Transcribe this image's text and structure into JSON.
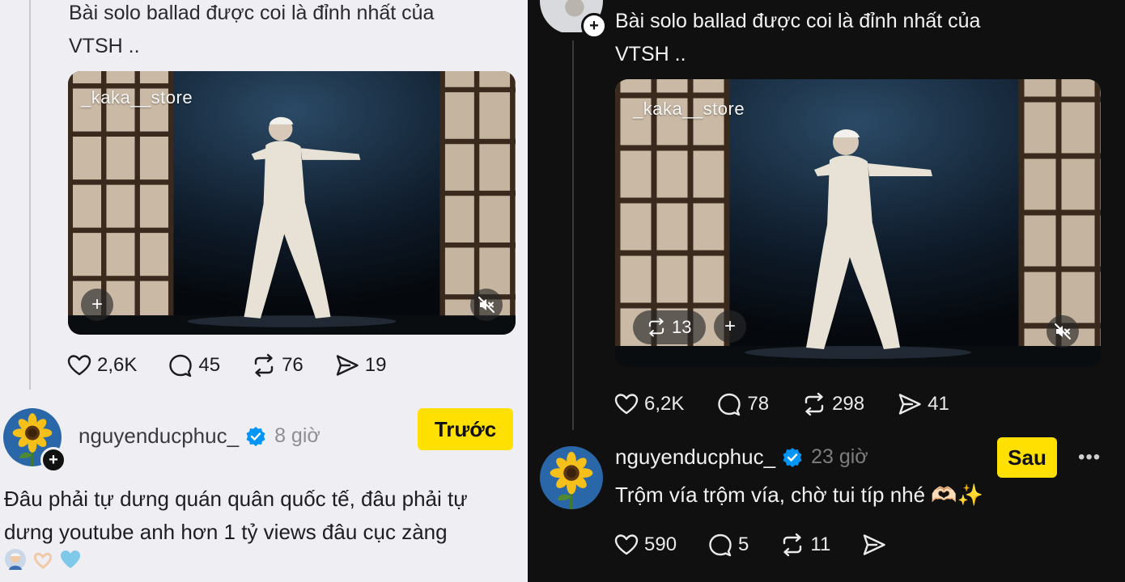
{
  "left": {
    "post_text": [
      "Bài solo ballad được coi là đỉnh nhất của",
      "VTSH .."
    ],
    "watermark": "_kaka__store",
    "stats": {
      "likes": "2,6K",
      "comments": "45",
      "reposts": "76",
      "shares": "19"
    },
    "comment": {
      "username": "nguyenducphuc_",
      "time": "8 giờ",
      "text": [
        "Đâu phải tự dưng quán quân quốc tế, đâu phải tự",
        "dưng youtube anh hơn 1 tỷ views đâu cục zàng"
      ],
      "tag": "Trước"
    }
  },
  "right": {
    "post_text": [
      "Bài solo ballad được coi là đỉnh nhất của",
      "VTSH .."
    ],
    "watermark": "_kaka__store",
    "media_reposts": "13",
    "stats": {
      "likes": "6,2K",
      "comments": "78",
      "reposts": "298",
      "shares": "41"
    },
    "comment": {
      "username": "nguyenducphuc_",
      "time": "23 giờ",
      "text": "Trộm vía trộm vía, chờ tui típ nhé 🫶🏻✨",
      "tag": "Sau",
      "stats": {
        "likes": "590",
        "comments": "5",
        "reposts": "11"
      }
    }
  },
  "colors": {
    "tag_yellow": "#ffe000",
    "verified_blue": "#0095f6",
    "light_bg": "#efeef3",
    "dark_bg": "#101010"
  }
}
